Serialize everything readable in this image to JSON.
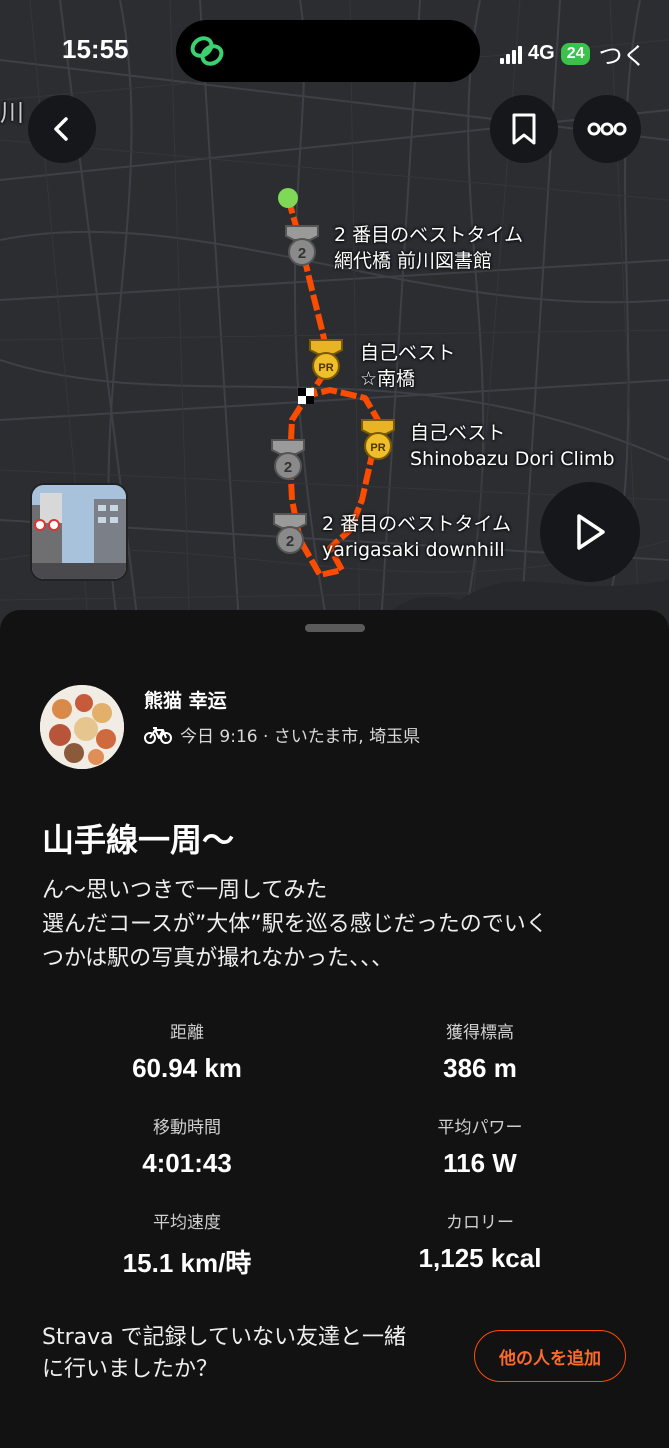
{
  "status_bar": {
    "time": "15:55",
    "network": "4G",
    "battery": "24",
    "carrier_text": "つく"
  },
  "map": {
    "place_text": "川",
    "segments": [
      {
        "badge": "2",
        "line1": "2 番目のベストタイム",
        "line2": "網代橋 前川図書館"
      },
      {
        "badge": "PR",
        "line1": "自己ベスト",
        "line2": "☆南橋"
      },
      {
        "badge": "PR",
        "line1": "自己ベスト",
        "line2": "Shinobazu Dori Climb"
      },
      {
        "badge": "2",
        "line1": "",
        "line2": ""
      },
      {
        "badge": "2",
        "line1": "2 番目のベストタイム",
        "line2": "yarigasaki downhill"
      }
    ],
    "route_color": "#fc4c02",
    "start_color": "#7ed957"
  },
  "activity": {
    "athlete_name": "熊猫 幸运",
    "meta": "今日 9:16 · さいたま市, 埼玉県",
    "title": "山手線一周〜",
    "description": [
      "ん〜思いつきで一周してみた",
      "選んだコースが”大体”駅を巡る感じだったのでいく",
      "つかは駅の写真が撮れなかった、、、"
    ],
    "stats": [
      {
        "label": "距離",
        "value": "60.94 km"
      },
      {
        "label": "獲得標高",
        "value": "386 m"
      },
      {
        "label": "移動時間",
        "value": "4:01:43"
      },
      {
        "label": "平均パワー",
        "value": "116 W"
      },
      {
        "label": "平均速度",
        "value": "15.1 km/時"
      },
      {
        "label": "カロリー",
        "value": "1,125 kcal"
      }
    ],
    "friend_question": [
      "Strava で記録していない友達と一緒",
      "に行いましたか？"
    ],
    "add_button": "他の人を追加"
  },
  "colors": {
    "accent": "#fc4c02",
    "background": "#121212"
  }
}
